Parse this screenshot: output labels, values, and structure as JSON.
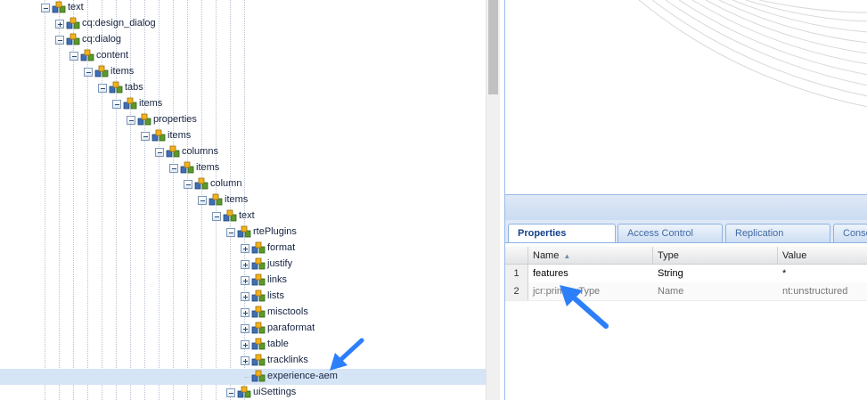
{
  "tree": {
    "nodes": [
      {
        "label": "text",
        "expanded": true
      },
      {
        "label": "cq:design_dialog",
        "expanded": false
      },
      {
        "label": "cq:dialog",
        "expanded": true
      },
      {
        "label": "content",
        "expanded": true
      },
      {
        "label": "items",
        "expanded": true
      },
      {
        "label": "tabs",
        "expanded": true
      },
      {
        "label": "items",
        "expanded": true
      },
      {
        "label": "properties",
        "expanded": true
      },
      {
        "label": "items",
        "expanded": true
      },
      {
        "label": "columns",
        "expanded": true
      },
      {
        "label": "items",
        "expanded": true
      },
      {
        "label": "column",
        "expanded": true
      },
      {
        "label": "items",
        "expanded": true
      },
      {
        "label": "text",
        "expanded": true
      },
      {
        "label": "rtePlugins",
        "expanded": true
      },
      {
        "label": "format",
        "expanded": false
      },
      {
        "label": "justify",
        "expanded": false
      },
      {
        "label": "links",
        "expanded": false
      },
      {
        "label": "lists",
        "expanded": false
      },
      {
        "label": "misctools",
        "expanded": false
      },
      {
        "label": "paraformat",
        "expanded": false
      },
      {
        "label": "table",
        "expanded": false
      },
      {
        "label": "tracklinks",
        "expanded": false
      },
      {
        "label": "experience-aem",
        "expanded": null,
        "selected": true
      },
      {
        "label": "uiSettings",
        "expanded": true
      }
    ]
  },
  "tabs": [
    {
      "label": "Properties",
      "active": true
    },
    {
      "label": "Access Control",
      "active": false
    },
    {
      "label": "Replication",
      "active": false
    },
    {
      "label": "Conso",
      "active": false
    }
  ],
  "grid": {
    "columns": [
      "Name",
      "Type",
      "Value"
    ],
    "sort_indicator": "▲",
    "rows": [
      {
        "num": "1",
        "name": "features",
        "type": "String",
        "value": "*"
      },
      {
        "num": "2",
        "name": "jcr:primaryType",
        "type": "Name",
        "value": "nt:unstructured"
      }
    ]
  },
  "colors": {
    "accent": "#2d7ff9",
    "selected_row": "#d6e5f6",
    "tab_text": "#15428b"
  }
}
